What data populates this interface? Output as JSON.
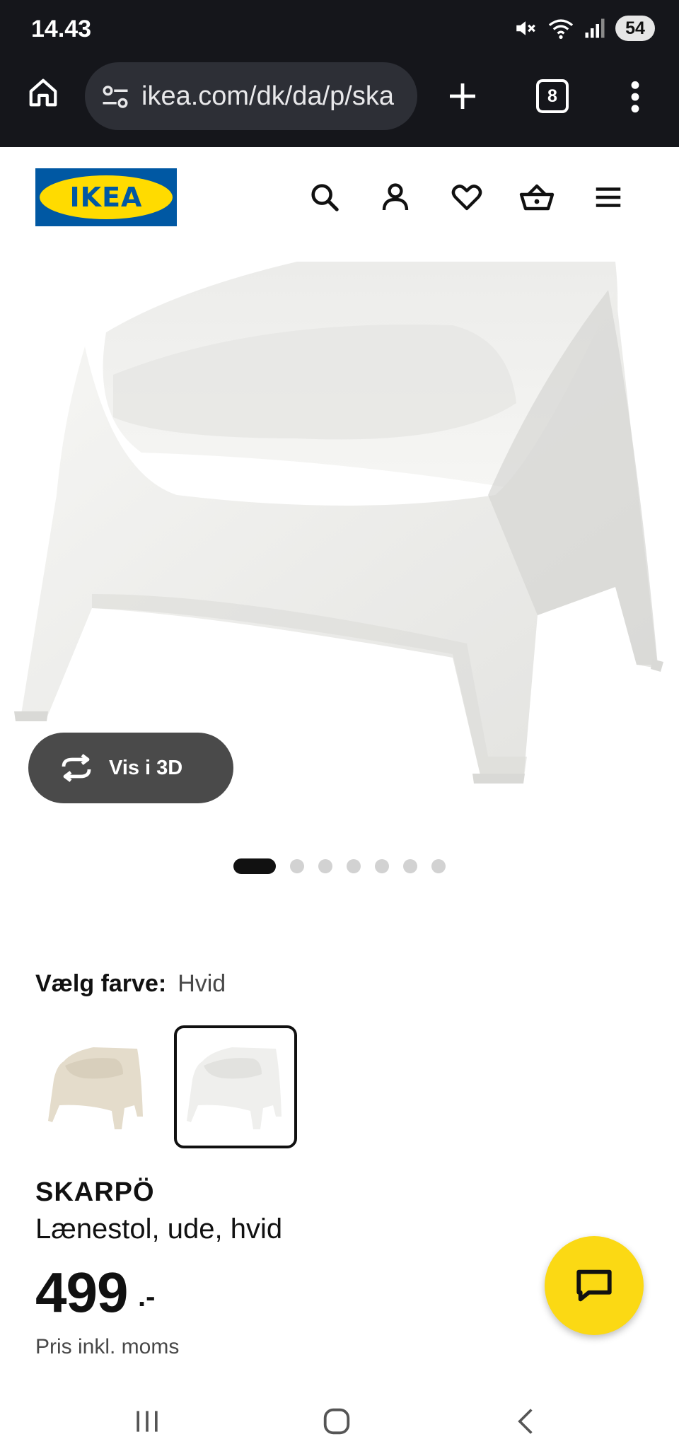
{
  "status_bar": {
    "time": "14.43",
    "battery": "54",
    "icons": [
      "mute-icon",
      "wifi-icon",
      "signal-icon",
      "battery-icon"
    ]
  },
  "browser": {
    "url": "ikea.com/dk/da/p/ska",
    "tab_count": "8",
    "icons": [
      "home-icon",
      "site-settings-icon",
      "new-tab-icon",
      "tabs-icon",
      "more-icon"
    ]
  },
  "header": {
    "logo_text": "IKEA",
    "icons": [
      "search-icon",
      "account-icon",
      "heart-icon",
      "basket-icon",
      "menu-icon"
    ]
  },
  "gallery": {
    "view_3d_label": "Vis i 3D",
    "image_count": 7,
    "active_index": 0
  },
  "color_picker": {
    "label": "Vælg farve:",
    "selected_value": "Hvid",
    "options": [
      {
        "name": "beige",
        "tint": "#e4dccb",
        "selected": false
      },
      {
        "name": "white",
        "tint": "#f2f2f0",
        "selected": true
      }
    ]
  },
  "product": {
    "name": "SKARPÖ",
    "description": "Lænestol, ude, hvid",
    "price": "499",
    "price_suffix": ".-",
    "price_note": "Pris inkl. moms"
  },
  "colors": {
    "ikea_blue": "#0058a3",
    "ikea_yellow": "#ffdb00",
    "chat_yellow": "#fbd914",
    "chrome_dark": "#15161b"
  },
  "android_nav": {
    "icons": [
      "recents-icon",
      "home-nav-icon",
      "back-icon"
    ]
  }
}
